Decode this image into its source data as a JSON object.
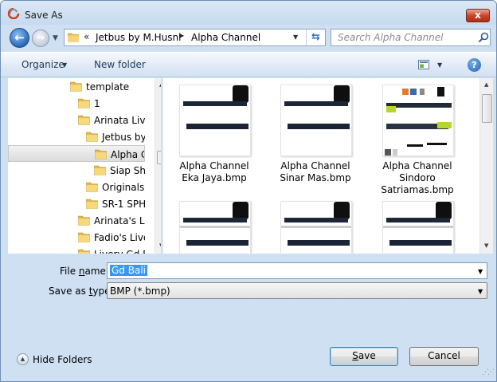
{
  "window": {
    "title": "Save As",
    "close_label": "x"
  },
  "nav": {
    "back_glyph": "←",
    "forward_glyph": "→"
  },
  "address": {
    "chevron": "«",
    "segments": [
      "Jetbus by M.Husni",
      "Alpha Channel"
    ]
  },
  "search": {
    "placeholder": "Search Alpha Channel"
  },
  "toolbar": {
    "organize_label": "Organize",
    "new_folder_label": "New folder",
    "help_glyph": "?"
  },
  "tree": {
    "items": [
      {
        "label": "template",
        "indent": 4,
        "selected": false
      },
      {
        "label": "1",
        "indent": 5,
        "selected": false
      },
      {
        "label": "Arinata Liver",
        "indent": 5,
        "selected": false
      },
      {
        "label": "Jetbus by M",
        "indent": 6,
        "selected": false
      },
      {
        "label": "Alpha Ch",
        "indent": 7,
        "selected": true
      },
      {
        "label": "Siap Sha",
        "indent": 7,
        "selected": false
      },
      {
        "label": "Originals",
        "indent": 6,
        "selected": false
      },
      {
        "label": "SR-1 SPH",
        "indent": 6,
        "selected": false
      },
      {
        "label": "Arinata's Liv",
        "indent": 5,
        "selected": false
      },
      {
        "label": "Fadio's Liver",
        "indent": 5,
        "selected": false
      },
      {
        "label": "Livery Gd Ba",
        "indent": 5,
        "selected": false
      }
    ]
  },
  "files": {
    "items": [
      {
        "label": "Alpha Channel Eka Jaya.bmp",
        "lines": [
          "Alpha Channel",
          "Eka Jaya.bmp"
        ]
      },
      {
        "label": "Alpha Channel Sinar Mas.bmp",
        "lines": [
          "Alpha Channel",
          "Sinar Mas.bmp"
        ]
      },
      {
        "label": "Alpha Channel Sindoro Satriamas.bmp",
        "lines": [
          "Alpha Channel",
          "Sindoro",
          "Satriamas.bmp"
        ]
      },
      {
        "label": "",
        "lines": []
      },
      {
        "label": "",
        "lines": []
      },
      {
        "label": "",
        "lines": []
      }
    ]
  },
  "fields": {
    "file_name_label_prefix": "File ",
    "file_name_label_u": "n",
    "file_name_label_suffix": "ame:",
    "file_name_value": "Gd Bali",
    "save_type_label_prefix": "Save as ",
    "save_type_label_u": "t",
    "save_type_label_suffix": "ype:",
    "save_type_value": "BMP (*.bmp)"
  },
  "footer": {
    "hide_folders_label": "Hide Folders",
    "save_label_u": "S",
    "save_label_rest": "ave",
    "cancel_label": "Cancel"
  },
  "colors": {
    "accent": "#3399ff",
    "frame": "#cfe0f3",
    "selection": "#dcdcdc"
  }
}
